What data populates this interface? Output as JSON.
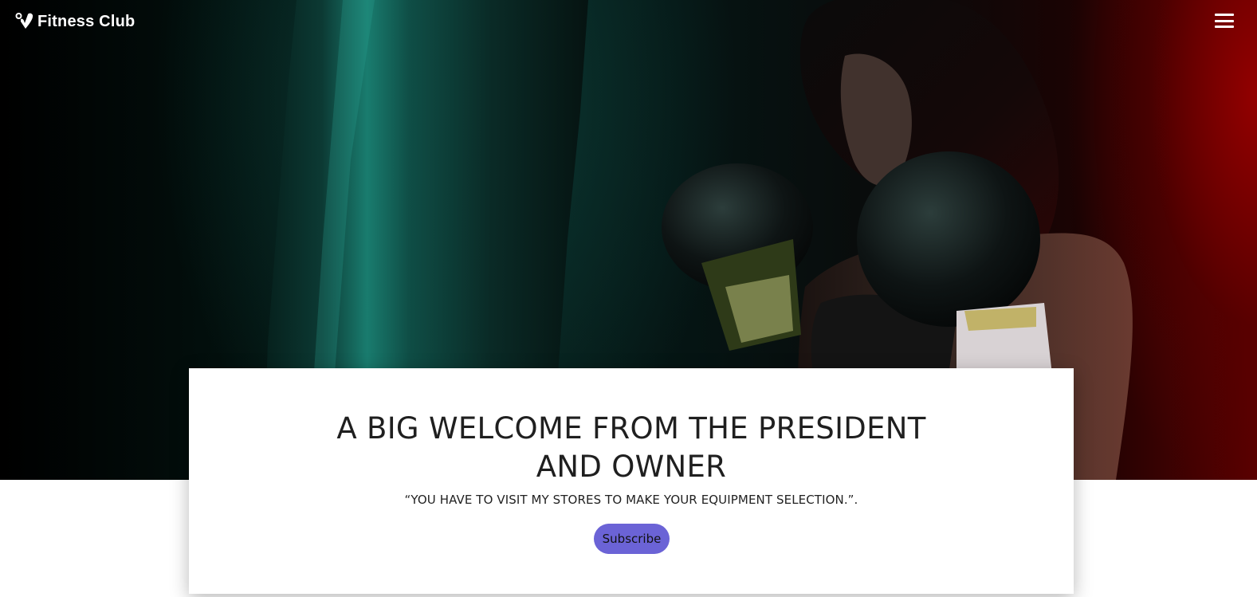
{
  "navbar": {
    "brand_name": "Fitness Club",
    "brand_icon": "heart-pulse-icon",
    "menu_icon": "hamburger-menu-icon"
  },
  "hero": {
    "image_description_icon": "boxing-hero-image"
  },
  "welcome": {
    "title": "A BIG WELCOME FROM THE PRESIDENT AND OWNER",
    "quote": "“YOU HAVE TO VISIT MY STORES TO MAKE YOUR EQUIPMENT SELECTION.”.",
    "subscribe_label": "Subscribe"
  },
  "colors": {
    "accent": "#6b63d6",
    "hero_left": "#0b2e2a",
    "hero_right": "#7a0000"
  }
}
